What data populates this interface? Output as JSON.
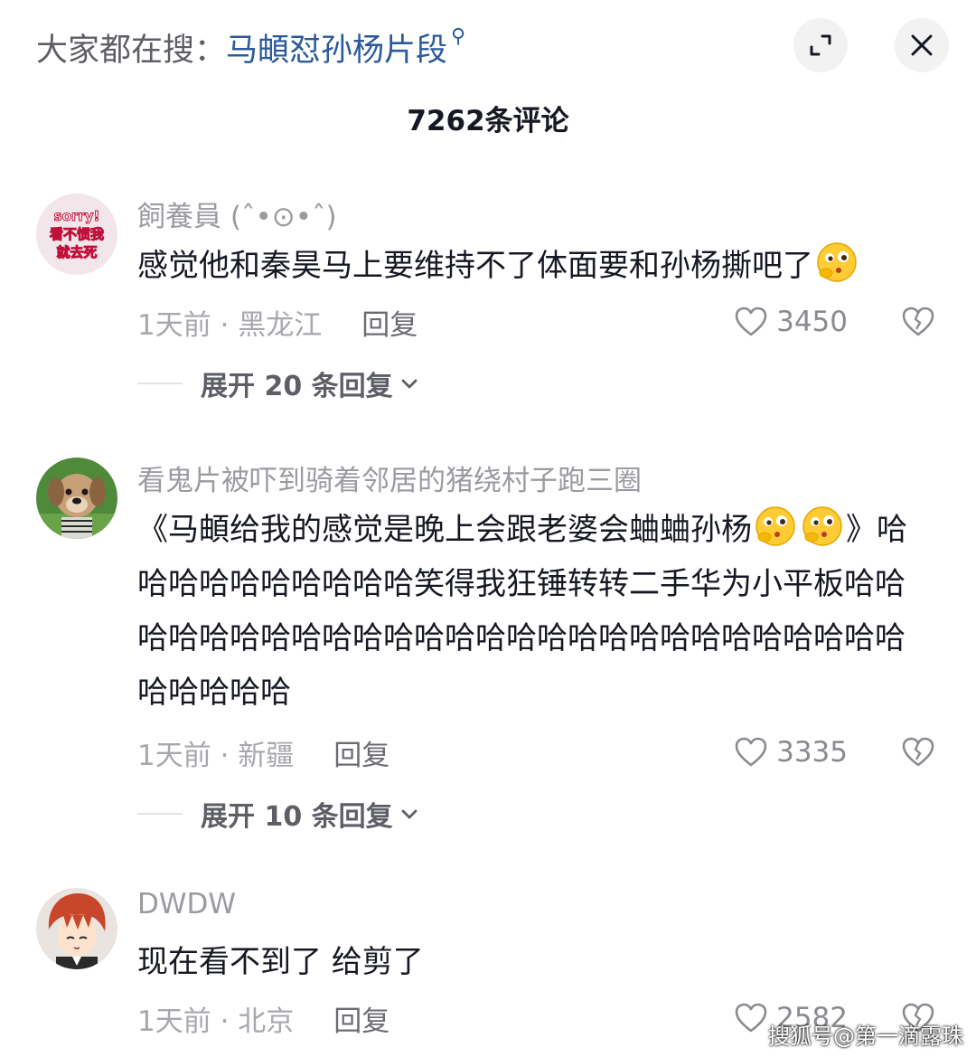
{
  "header": {
    "search_prefix": "大家都在搜：",
    "search_term": "马頔怼孙杨片段",
    "search_glyph": "⚲",
    "collapse_icon": "collapse-icon",
    "close_icon": "close-icon"
  },
  "comment_count": "7262条评论",
  "comments": [
    {
      "username": "飼養員 (ˆ•⊙•ˆ)",
      "avatar_text": [
        "sorry!",
        "看不惯我",
        "就去死"
      ],
      "text_parts": [
        "感觉他和秦昊马上要维持不了体面要和孙杨撕吧了"
      ],
      "time_location": "1天前 · 黑龙江",
      "reply_label": "回复",
      "likes": "3450",
      "expand_label": "展开 20 条回复"
    },
    {
      "username": "看鬼片被吓到骑着邻居的猪绕村子跑三圈",
      "text_parts": [
        "《马頔给我的感觉是晚上会跟老婆会蛐蛐孙杨",
        "》哈哈哈哈哈哈哈哈哈哈笑得我狂锤转转二手华为小平板哈哈哈哈哈哈哈哈哈哈哈哈哈哈哈哈哈哈哈哈哈哈哈哈哈哈哈哈哈哈哈哈"
      ],
      "time_location": "1天前 · 新疆",
      "reply_label": "回复",
      "likes": "3335",
      "expand_label": "展开 10 条回复"
    },
    {
      "username": "DWDW",
      "text_parts": [
        "现在看不到了 给剪了"
      ],
      "time_location": "1天前 · 北京",
      "reply_label": "回复",
      "likes": "2582"
    }
  ],
  "watermark": "搜狐号@第一滴露珠",
  "colors": {
    "search_term": "#2a5a9a",
    "meta_gray": "#a7a8ad",
    "text": "#161823"
  }
}
